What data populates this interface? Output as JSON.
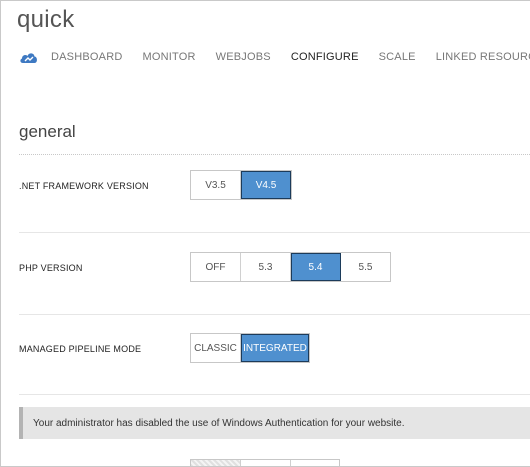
{
  "site": {
    "title": "quick"
  },
  "nav": {
    "items": [
      {
        "label": "DASHBOARD",
        "active": false
      },
      {
        "label": "MONITOR",
        "active": false
      },
      {
        "label": "WEBJOBS",
        "active": false
      },
      {
        "label": "CONFIGURE",
        "active": true
      },
      {
        "label": "SCALE",
        "active": false
      },
      {
        "label": "LINKED RESOURCES",
        "active": false
      }
    ],
    "icon": "cloud-icon"
  },
  "section": {
    "title": "general"
  },
  "settings": {
    "net": {
      "label": ".NET FRAMEWORK VERSION",
      "options": [
        "V3.5",
        "V4.5"
      ],
      "selected": "V4.5"
    },
    "php": {
      "label": "PHP VERSION",
      "options": [
        "OFF",
        "5.3",
        "5.4",
        "5.5"
      ],
      "selected": "5.4"
    },
    "pipeline": {
      "label": "MANAGED PIPELINE MODE",
      "options": [
        "CLASSIC",
        "INTEGRATED"
      ],
      "selected": "INTEGRATED"
    }
  },
  "notice": {
    "text": "Your administrator has disabled the use of Windows Authentication for your website."
  },
  "colors": {
    "accent": "#4f90cf",
    "nav_active": "#222222",
    "nav_inactive": "#777777"
  }
}
